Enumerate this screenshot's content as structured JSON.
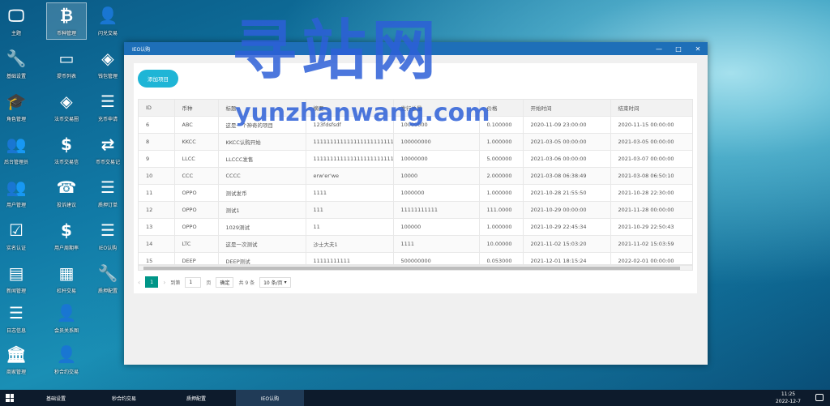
{
  "desktop": {
    "icons": [
      {
        "label": "主题",
        "icon": "monitor-icon"
      },
      {
        "label": "币种管理",
        "icon": "bitcoin-icon"
      },
      {
        "label": "闪兑交易",
        "icon": "user-add-icon"
      },
      {
        "label": "基础设置",
        "icon": "wrench-icon"
      },
      {
        "label": "提币列表",
        "icon": "card-icon"
      },
      {
        "label": "钱包管理",
        "icon": "wallet-icon"
      },
      {
        "label": "角色管理",
        "icon": "graduation-cap-icon"
      },
      {
        "label": "法币交易圈",
        "icon": "diamond-icon"
      },
      {
        "label": "充币申请",
        "icon": "list-icon"
      },
      {
        "label": "后台管理员",
        "icon": "users-icon"
      },
      {
        "label": "法币交易信",
        "icon": "dollar-icon"
      },
      {
        "label": "币币交易记",
        "icon": "exchange-icon"
      },
      {
        "label": "用户管理",
        "icon": "group-icon"
      },
      {
        "label": "投诉建议",
        "icon": "phone-icon"
      },
      {
        "label": "质押订单",
        "icon": "list-icon"
      },
      {
        "label": "实名认证",
        "icon": "check-icon"
      },
      {
        "label": "用户周期率",
        "icon": "dollar-icon"
      },
      {
        "label": "IEO认购",
        "icon": "list-icon"
      },
      {
        "label": "新闻管理",
        "icon": "newspaper-icon"
      },
      {
        "label": "杠杆交易",
        "icon": "table-icon"
      },
      {
        "label": "质押配置",
        "icon": "wrench-icon"
      },
      {
        "label": "日志信息",
        "icon": "list-icon"
      },
      {
        "label": "会员关系图",
        "icon": "user-add-icon"
      },
      {
        "label": "商家管理",
        "icon": "bank-icon"
      },
      {
        "label": "秒合约交易",
        "icon": "user-add-icon"
      }
    ]
  },
  "window": {
    "title": "IEO认购",
    "add_button": "添加项目",
    "columns": [
      "ID",
      "币种",
      "标题",
      "摘要",
      "发行总量",
      "价格",
      "开始时间",
      "结束时间"
    ],
    "rows": [
      [
        "6",
        "ABC",
        "这是一个神奇的项目",
        "123fdsfsdf",
        "10000000",
        "0.100000",
        "2020-11-09 23:00:00",
        "2020-11-15 00:00:00"
      ],
      [
        "8",
        "KKCC",
        "KKCC认购开始",
        "1111111111111111111111111",
        "100000000",
        "1.000000",
        "2021-03-05 00:00:00",
        "2021-03-05 00:00:00"
      ],
      [
        "9",
        "LLCC",
        "LLCCC发售",
        "1111111111111111111111111",
        "10000000",
        "5.000000",
        "2021-03-06 00:00:00",
        "2021-03-07 00:00:00"
      ],
      [
        "10",
        "CCC",
        "CCCC",
        "erw'er'we",
        "10000",
        "2.000000",
        "2021-03-08 06:38:49",
        "2021-03-08 06:50:10"
      ],
      [
        "11",
        "OPPO",
        "测试发币",
        "1111",
        "1000000",
        "1.000000",
        "2021-10-28 21:55:50",
        "2021-10-28 22:30:00"
      ],
      [
        "12",
        "OPPO",
        "测试1",
        "111",
        "11111111111",
        "111.0000",
        "2021-10-29 00:00:00",
        "2021-11-28 00:00:00"
      ],
      [
        "13",
        "OPPO",
        "1029测试",
        "11",
        "100000",
        "1.000000",
        "2021-10-29 22:45:34",
        "2021-10-29 22:50:43"
      ],
      [
        "14",
        "LTC",
        "这是一次测试",
        "沙士大夫1",
        "1111",
        "10.00000",
        "2021-11-02 15:03:20",
        "2021-11-02 15:03:59"
      ],
      [
        "15",
        "DEEP",
        "DEEP测试",
        "11111111111",
        "500000000",
        "0.053000",
        "2021-12-01 18:15:24",
        "2022-02-01 00:00:00"
      ]
    ],
    "pager": {
      "current": "1",
      "goto_label": "到第",
      "page_value": "1",
      "page_unit": "页",
      "confirm": "确定",
      "total": "共 9 条",
      "page_size": "10 条/页"
    }
  },
  "taskbar": {
    "tasks": [
      "基础设置",
      "秒合约交易",
      "质押配置",
      "IEO认购"
    ],
    "time": "11:25",
    "date": "2022-12-7"
  },
  "watermark": {
    "cn": "寻站网",
    "en": "yunzhanwang.com"
  }
}
